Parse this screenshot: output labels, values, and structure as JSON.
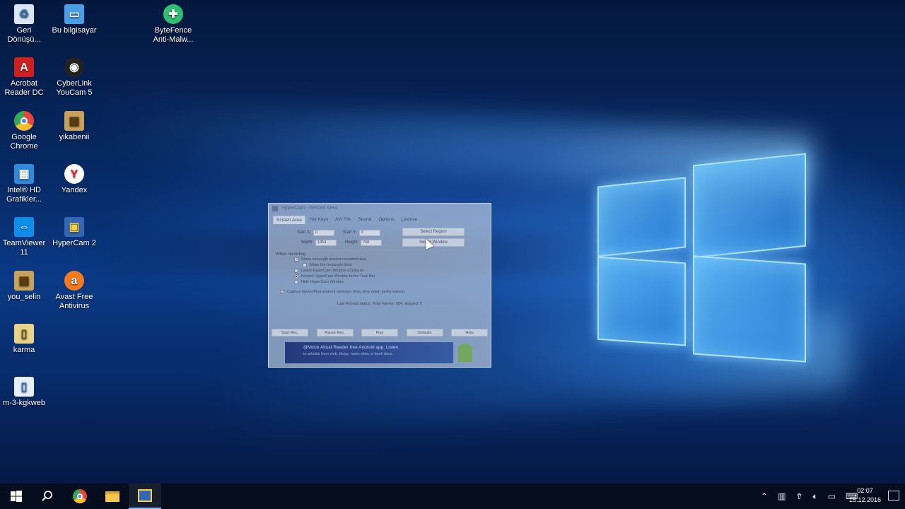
{
  "desktop": {
    "icons": [
      {
        "label": "Geri\nDönüşü...",
        "icon": "recycle-bin-icon",
        "color": "#d9e6f5"
      },
      {
        "label": "Bu bilgisayar",
        "icon": "computer-icon",
        "color": "#4a9ee8"
      },
      {
        "label": "ByteFence\nAnti-Malw...",
        "icon": "bytefence-icon",
        "color": "#2fbf71"
      },
      {
        "label": "Acrobat\nReader DC",
        "icon": "acrobat-icon",
        "color": "#d11f1f"
      },
      {
        "label": "CyberLink\nYouCam 5",
        "icon": "youcam-icon",
        "color": "#222222"
      },
      {
        "label": "Google\nChrome",
        "icon": "chrome-icon",
        "color": "#e8453c"
      },
      {
        "label": "yikabenii",
        "icon": "archive-icon",
        "color": "#c9a15a"
      },
      {
        "label": "Intel® HD\nGrafikler...",
        "icon": "intel-icon",
        "color": "#2f8ad9"
      },
      {
        "label": "Yandex",
        "icon": "yandex-icon",
        "color": "#ffffff"
      },
      {
        "label": "TeamViewer\n11",
        "icon": "teamviewer-icon",
        "color": "#0e8ee9"
      },
      {
        "label": "HyperCam 2",
        "icon": "hypercam-icon",
        "color": "#3466b5"
      },
      {
        "label": "you_selin",
        "icon": "archive-icon",
        "color": "#c9a15a"
      },
      {
        "label": "Avast Free\nAntivirus",
        "icon": "avast-icon",
        "color": "#f47a20"
      },
      {
        "label": "karma",
        "icon": "file-icon",
        "color": "#e9d38a"
      },
      {
        "label": "m-3-kgkweb",
        "icon": "file-icon",
        "color": "#e6eef8"
      }
    ]
  },
  "hypercam": {
    "title": "HyperCam - Record Area",
    "tabs": [
      "Screen Area",
      "Hot Keys",
      "AVI File",
      "Sound",
      "Options",
      "License"
    ],
    "start_x_label": "Start X:",
    "start_x": "0",
    "start_y_label": "Start Y:",
    "start_y": "0",
    "width_label": "Width:",
    "width": "1364",
    "height_label": "Height:",
    "height": "768",
    "select_region": "Select Region",
    "select_window": "Select Window",
    "group_title": "When recording",
    "opt1": "Show rectangle around recorded area",
    "opt2": "Make the rectangle blink",
    "opt3": "Leave HyperCam Window (Opaque)",
    "opt4": "Iconize HyperCam Window to the Task Bar",
    "opt5": "Hide HyperCam Window",
    "opt6": "Capture layered/transparent windows (may slow down performance)",
    "status": "Last Record Status: Total frames: 654, skipped: 0",
    "btn_start": "Start Rec.",
    "btn_pause": "Pause Rec.",
    "btn_play": "Play",
    "btn_defaults": "Defaults",
    "btn_help": "Help",
    "ad_title": "@Voice Aloud Reader  free Android app: Listen",
    "ad_sub": "to articles from web, blogs, news sites, e-book docs"
  },
  "taskbar": {
    "start": "windows-start-icon",
    "time": "02:07",
    "date": "15.12.2016"
  }
}
